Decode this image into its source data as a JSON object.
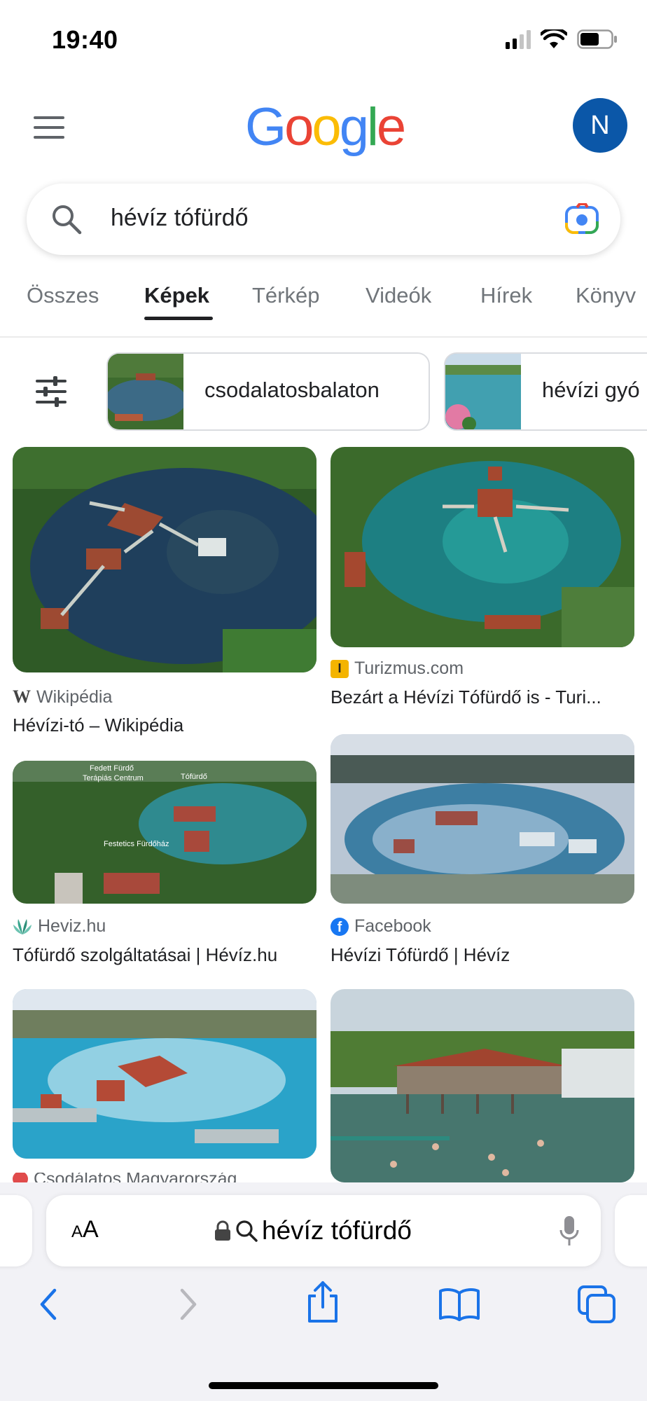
{
  "status": {
    "time": "19:40"
  },
  "header": {
    "logo": "Google",
    "avatar_letter": "N"
  },
  "search": {
    "query": "hévíz tófürdő"
  },
  "tabs": [
    {
      "label": "Összes"
    },
    {
      "label": "Képek"
    },
    {
      "label": "Térkép"
    },
    {
      "label": "Videók"
    },
    {
      "label": "Hírek"
    },
    {
      "label": "Könyv"
    }
  ],
  "chips": [
    {
      "label": "csodalatosbalaton"
    },
    {
      "label": "hévízi gyó"
    }
  ],
  "results": [
    {
      "source": "Wikipédia",
      "title": "Hévízi-tó – Wikipédia",
      "source_icon": "wikipedia-icon"
    },
    {
      "source": "Turizmus.com",
      "title": "Bezárt a Hévízi Tófürdő is - Turi...",
      "source_icon": "turizmus-icon"
    },
    {
      "source": "Heviz.hu",
      "title": "Tófürdő szolgáltatásai | Hévíz.hu",
      "source_icon": "heviz-icon"
    },
    {
      "source": "Facebook",
      "title": "Hévízi Tófürdő | Hévíz",
      "source_icon": "facebook-icon"
    },
    {
      "source": "Csodálatos Magyarország",
      "title": "",
      "source_icon": "site-icon"
    }
  ],
  "image_labels": {
    "a": "Fedett Fürdő",
    "b": "Terápiás Centrum",
    "c": "Tófürdő",
    "d": "Festetics Fürdőház"
  },
  "safari": {
    "text_size": "AA",
    "url": "hévíz tófürdő"
  },
  "colors": {
    "accent_blue": "#1a73e8",
    "avatar": "#0b57a8",
    "google_blue": "#4285f4",
    "google_red": "#ea4335",
    "google_yellow": "#fbbc05",
    "google_green": "#34a853"
  }
}
